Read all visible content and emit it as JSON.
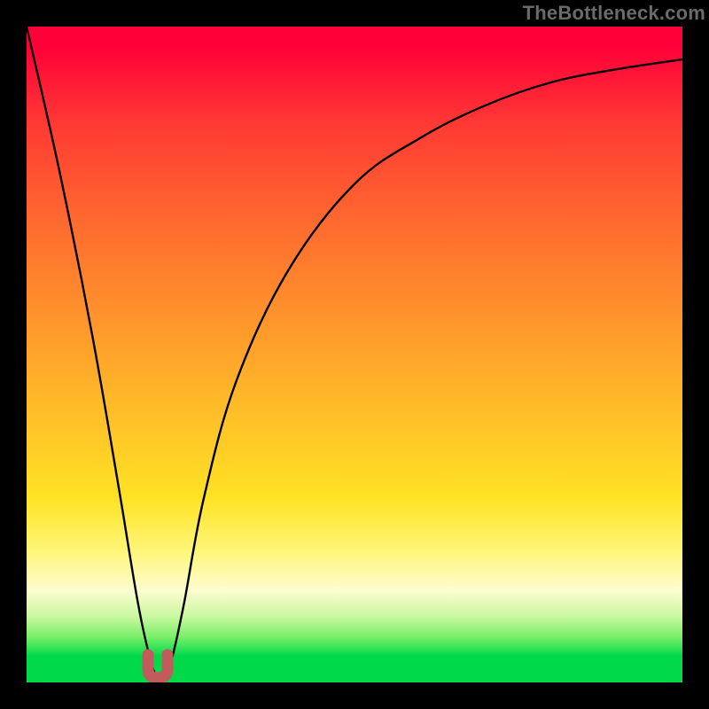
{
  "watermark": "TheBottleneck.com",
  "colors": {
    "frame": "#000000",
    "curve": "#000000",
    "marker": "#c25b5b",
    "gradient_top": "#ff0038",
    "gradient_bottom": "#00d94a"
  },
  "chart_data": {
    "type": "line",
    "title": "",
    "xlabel": "",
    "ylabel": "",
    "xlim": [
      0,
      100
    ],
    "ylim": [
      0,
      100
    ],
    "grid": false,
    "legend": false,
    "series": [
      {
        "name": "bottleneck-curve",
        "x": [
          0,
          5,
          10,
          14,
          17,
          19,
          20,
          21,
          22,
          24,
          27,
          32,
          40,
          50,
          60,
          70,
          80,
          90,
          100
        ],
        "y": [
          100,
          78,
          53,
          30,
          12,
          3,
          1,
          1,
          3,
          12,
          28,
          46,
          63,
          76,
          83,
          88,
          91.5,
          93.5,
          95
        ]
      }
    ],
    "annotations": [
      {
        "name": "minimum-marker",
        "shape": "u",
        "x": 20,
        "y": 1.5
      }
    ]
  }
}
